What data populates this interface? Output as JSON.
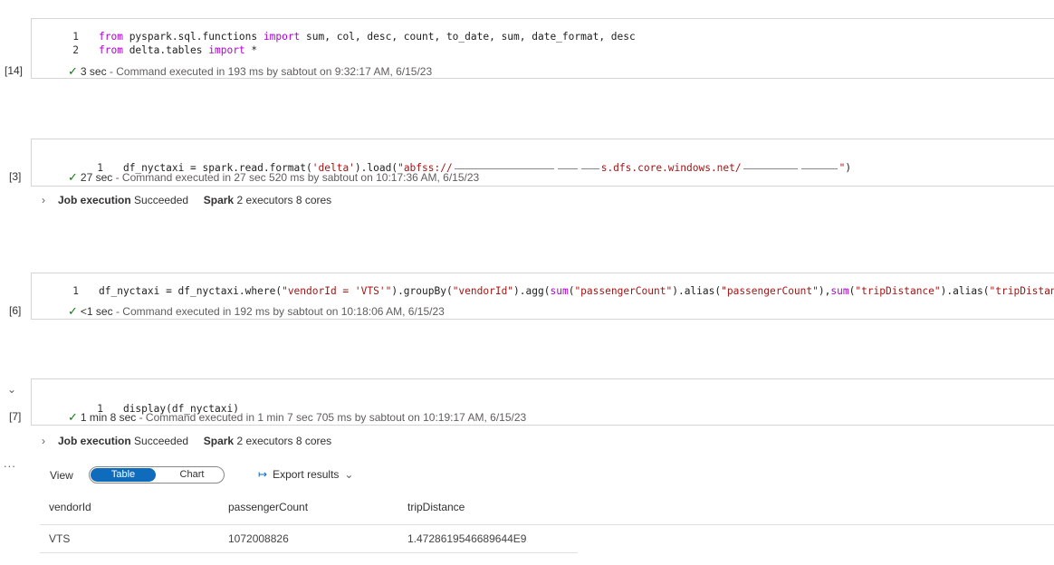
{
  "cells": [
    {
      "exec_count": "[14]",
      "lines": [
        {
          "num": "1",
          "parts": [
            {
              "t": "from ",
              "c": "kw"
            },
            {
              "t": "pyspark.sql.functions ",
              "c": ""
            },
            {
              "t": "import ",
              "c": "kw"
            },
            {
              "t": "sum, col, desc, count, to_date, sum, date_format, desc",
              "c": ""
            }
          ]
        },
        {
          "num": "2",
          "parts": [
            {
              "t": "from ",
              "c": "kw"
            },
            {
              "t": "delta.tables ",
              "c": ""
            },
            {
              "t": "import ",
              "c": "kw"
            },
            {
              "t": "*",
              "c": ""
            }
          ]
        }
      ],
      "status_duration": "3 sec",
      "status_text": " - Command executed in 193 ms by sabtout on 9:32:17 AM, 6/15/23"
    },
    {
      "exec_count": "[3]",
      "line_num": "1",
      "code_prefix": "df_nyctaxi = spark.read.format(",
      "code_str1": "'delta'",
      "code_mid": ").load(",
      "code_str2_start": "\"abfss://",
      "code_str2_mid": "s.dfs.core.windows.net/",
      "code_str2_end": "\"",
      "code_suffix": ")",
      "status_duration": "27 sec",
      "status_text": " - Command executed in 27 sec 520 ms by sabtout on 10:17:36 AM, 6/15/23",
      "job": {
        "label": "Job execution",
        "state": "Succeeded",
        "spark_label": "Spark",
        "spark_info": "2 executors 8 cores"
      }
    },
    {
      "exec_count": "[6]",
      "line_num": "1",
      "code": [
        {
          "t": "df_nyctaxi = df_nyctaxi.where(",
          "c": ""
        },
        {
          "t": "\"vendorId = 'VTS'\"",
          "c": "str"
        },
        {
          "t": ").groupBy(",
          "c": ""
        },
        {
          "t": "\"vendorId\"",
          "c": "str"
        },
        {
          "t": ").agg(",
          "c": ""
        },
        {
          "t": "sum",
          "c": "kw"
        },
        {
          "t": "(",
          "c": ""
        },
        {
          "t": "\"passengerCount\"",
          "c": "str"
        },
        {
          "t": ").alias(",
          "c": ""
        },
        {
          "t": "\"passengerCount\"",
          "c": "str"
        },
        {
          "t": "),",
          "c": ""
        },
        {
          "t": "sum",
          "c": "kw"
        },
        {
          "t": "(",
          "c": ""
        },
        {
          "t": "\"tripDistance\"",
          "c": "str"
        },
        {
          "t": ").alias(",
          "c": ""
        },
        {
          "t": "\"tripDistance\"",
          "c": "str"
        },
        {
          "t": "))",
          "c": ""
        }
      ],
      "status_duration": "<1 sec",
      "status_text": " - Command executed in 192 ms by sabtout on 10:18:06 AM, 6/15/23"
    },
    {
      "exec_count": "[7]",
      "line_num": "1",
      "code": "display(df_nyctaxi)",
      "status_duration": "1 min 8 sec",
      "status_text": " - Command executed in 1 min 7 sec 705 ms by sabtout on 10:19:17 AM, 6/15/23",
      "job": {
        "label": "Job execution",
        "state": "Succeeded",
        "spark_label": "Spark",
        "spark_info": "2 executors 8 cores"
      }
    }
  ],
  "output": {
    "more": "...",
    "view_label": "View",
    "toggle_table": "Table",
    "toggle_chart": "Chart",
    "export_label": "Export results",
    "columns": [
      "vendorId",
      "passengerCount",
      "tripDistance"
    ],
    "rows": [
      [
        "VTS",
        "1072008826",
        "1.4728619546689644E9"
      ]
    ]
  }
}
